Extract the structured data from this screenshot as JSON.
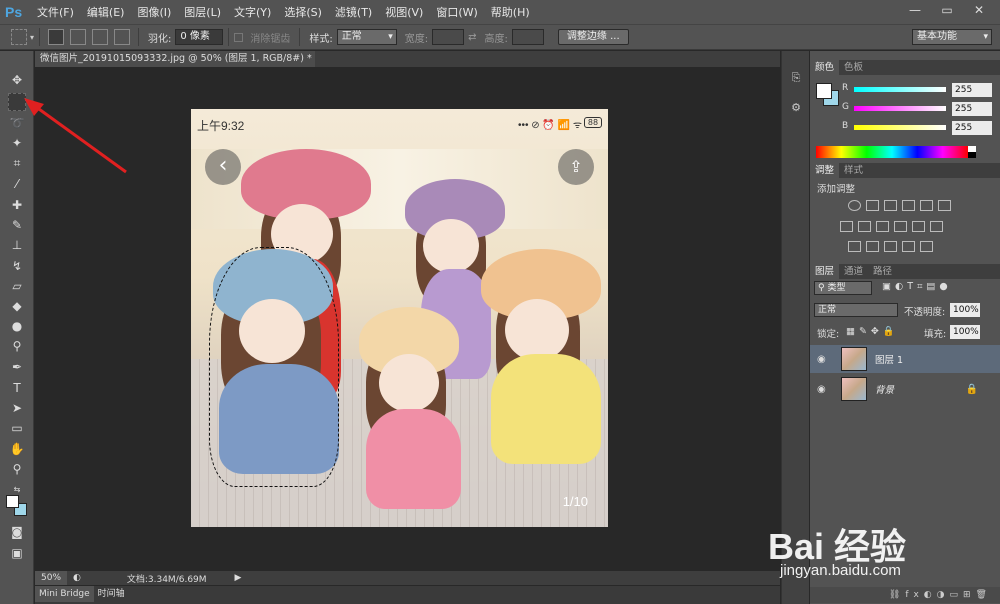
{
  "app": {
    "logo": "Ps"
  },
  "menu": [
    "文件(F)",
    "编辑(E)",
    "图像(I)",
    "图层(L)",
    "文字(Y)",
    "选择(S)",
    "滤镜(T)",
    "视图(V)",
    "窗口(W)",
    "帮助(H)"
  ],
  "window_controls": {
    "minimize": "—",
    "restore": "▭",
    "close": "✕"
  },
  "options": {
    "feather_label": "羽化:",
    "feather_value": "0 像素",
    "antialias_label": "消除锯齿",
    "style_label": "样式:",
    "style_value": "正常",
    "width_label": "宽度:",
    "height_label": "高度:",
    "refine_edge_button": "调整边缘 ...",
    "workspace": "基本功能"
  },
  "document": {
    "tab_title": "微信图片_20191015093332.jpg @ 50% (图层 1, RGB/8#) *",
    "phone_time": "上午9:32",
    "phone_status": "••• ⊘ ⏰ 📶 ᯤ",
    "battery": "88",
    "page_indicator": "1/10"
  },
  "status_bar": {
    "zoom": "50%",
    "doc_info": "文档:3.34M/6.69M"
  },
  "bottom_tabs": [
    "Mini Bridge",
    "时间轴"
  ],
  "color_panel": {
    "tabs": [
      "颜色",
      "色板"
    ],
    "r_label": "R",
    "r_value": "255",
    "g_label": "G",
    "g_value": "255",
    "b_label": "B",
    "b_value": "255"
  },
  "adjust_panel": {
    "tabs": [
      "调整",
      "样式"
    ],
    "title": "添加调整"
  },
  "layers_panel": {
    "tabs": [
      "图层",
      "通道",
      "路径"
    ],
    "filter_kind": "类型",
    "blend_mode": "正常",
    "opacity_label": "不透明度:",
    "opacity_value": "100%",
    "lock_label": "锁定:",
    "fill_label": "填充:",
    "fill_value": "100%",
    "layers": [
      {
        "name": "图层 1",
        "selected": true
      },
      {
        "name": "背景",
        "locked": true
      }
    ]
  },
  "watermark": {
    "logo": "Bai 经验",
    "url": "jingyan.baidu.com"
  },
  "colors": {
    "accent": "#4ea6e0",
    "arrow": "#e02020",
    "selected_layer": "#5d6a7a"
  }
}
